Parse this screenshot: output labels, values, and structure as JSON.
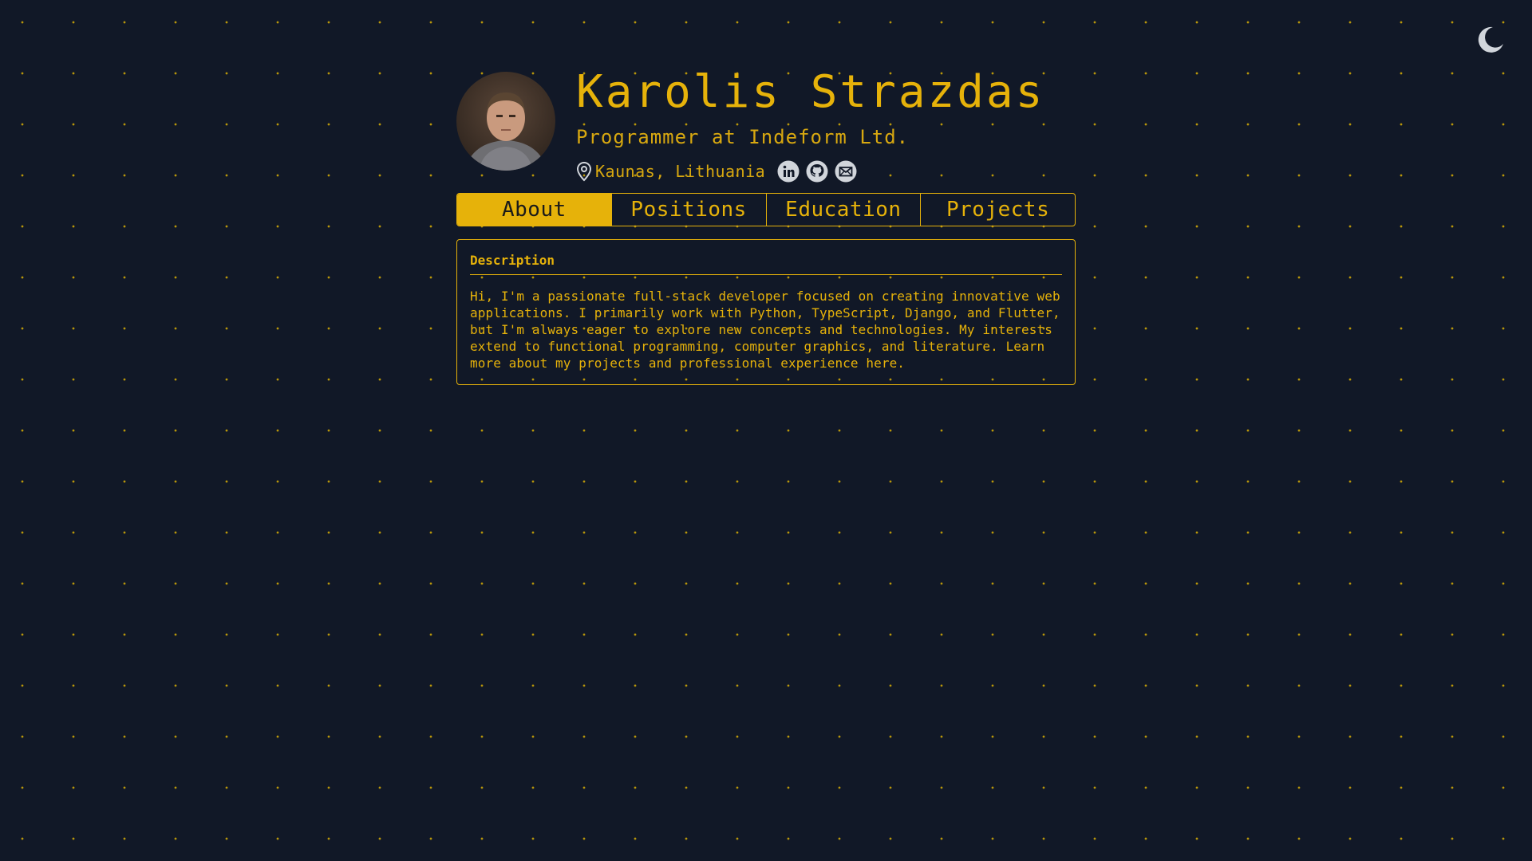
{
  "theme_toggle": {
    "icon": "moon-icon"
  },
  "profile": {
    "name": "Karolis Strazdas",
    "title": "Programmer at Indeform Ltd.",
    "location": "Kaunas, Lithuania",
    "avatar_alt": "profile photo"
  },
  "social": [
    {
      "icon": "linkedin-icon"
    },
    {
      "icon": "github-icon"
    },
    {
      "icon": "email-icon"
    }
  ],
  "tabs": [
    {
      "label": "About",
      "active": true
    },
    {
      "label": "Positions",
      "active": false
    },
    {
      "label": "Education",
      "active": false
    },
    {
      "label": "Projects",
      "active": false
    }
  ],
  "card": {
    "title": "Description",
    "body": "Hi, I'm a passionate full-stack developer focused on creating innovative web applications. I primarily work with Python, TypeScript, Django, and Flutter, but I'm always eager to explore new concepts and technologies. My interests extend to functional programming, computer graphics, and literature. Learn more about my projects and professional experience here."
  },
  "colors": {
    "background": "#111827",
    "accent": "#e6b20a",
    "icon_gray": "#d1d5db"
  }
}
